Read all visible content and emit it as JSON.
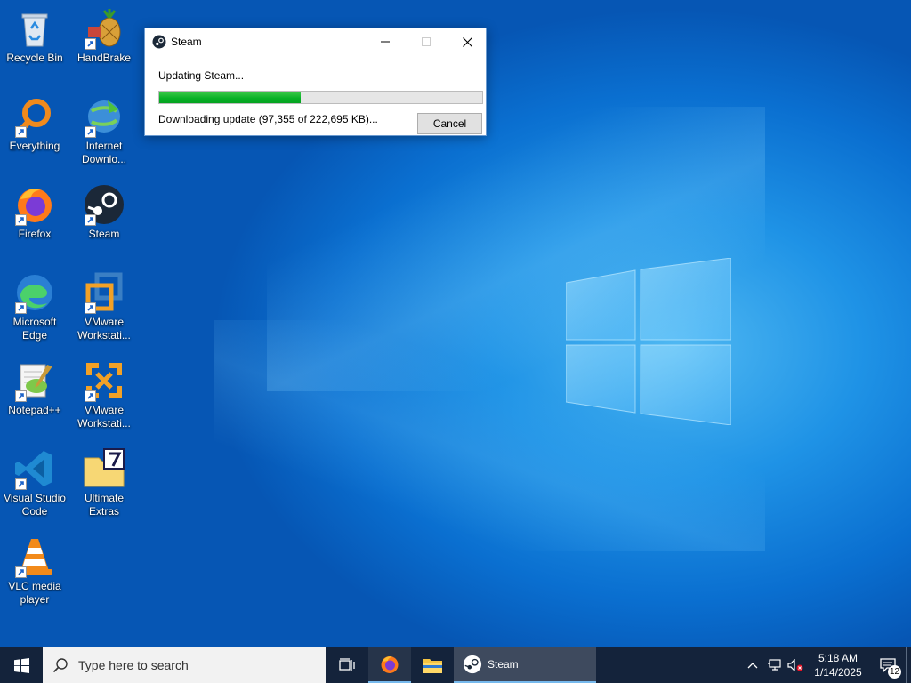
{
  "desktop": {
    "icons": [
      {
        "label": "Recycle Bin"
      },
      {
        "label": "HandBrake"
      },
      {
        "label": "Everything"
      },
      {
        "label": "Internet Downlo..."
      },
      {
        "label": "Firefox"
      },
      {
        "label": "Steam"
      },
      {
        "label": "Microsoft Edge"
      },
      {
        "label": "VMware Workstati..."
      },
      {
        "label": "Notepad++"
      },
      {
        "label": "VMware Workstati..."
      },
      {
        "label": "Visual Studio Code"
      },
      {
        "label": "Ultimate Extras"
      },
      {
        "label": "VLC media player"
      }
    ]
  },
  "dialog": {
    "title": "Steam",
    "status": "Updating Steam...",
    "progress_fraction": 0.437,
    "detail": "Downloading update (97,355 of 222,695 KB)...",
    "cancel_label": "Cancel"
  },
  "taskbar": {
    "search_placeholder": "Type here to search",
    "steam_label": "Steam",
    "time": "5:18 AM",
    "date": "1/14/2025",
    "notification_count": "12"
  },
  "colors": {
    "progress": "#06b025",
    "taskbar": "#14233b",
    "accent": "#76b9ed"
  }
}
